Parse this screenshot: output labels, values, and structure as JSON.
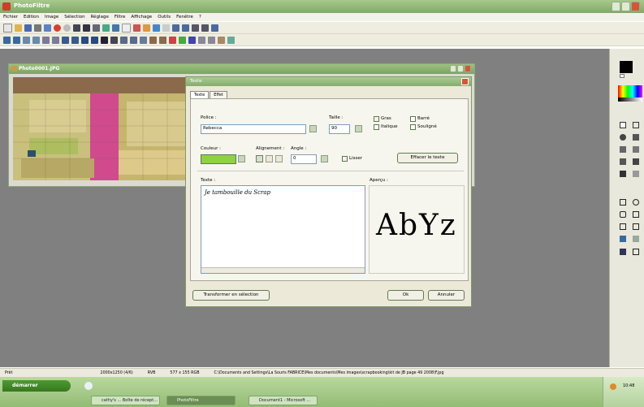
{
  "app": {
    "title": "PhotoFiltre"
  },
  "menu": [
    "Fichier",
    "Edition",
    "Image",
    "Sélection",
    "Réglage",
    "Filtre",
    "Affichage",
    "Outils",
    "Fenêtre",
    "?"
  ],
  "doc": {
    "title": "Photo0001.JPG"
  },
  "dialog": {
    "title": "Texte",
    "tabs": [
      "Texte",
      "Effet"
    ],
    "police_label": "Police :",
    "police_value": "Rebecca",
    "taille_label": "Taille :",
    "taille_value": "90",
    "gras": "Gras",
    "italique": "Italique",
    "barre": "Barré",
    "souligne": "Souligné",
    "couleur_label": "Couleur :",
    "alignement_label": "Alignement :",
    "angle_label": "Angle :",
    "angle_value": "0",
    "lisser": "Lisser",
    "effacer_btn": "Effacer le texte",
    "texte_label": "Texte :",
    "texte_value": "Je tambouille du Scrap",
    "apercu_label": "Aperçu :",
    "apercu_sample": "AbYz",
    "transform_btn": "Transformer en sélection",
    "ok_btn": "Ok",
    "annuler_btn": "Annuler",
    "color_swatch": "#8fd13f"
  },
  "status": {
    "ready": "Prêt",
    "size": "2000x1250 (4/6)",
    "mode": "RVB",
    "coords": "577 x 155 RGB",
    "path": "C:\\Documents and Settings\\La Souris FABRICE\\Mes documents\\Mes images\\scrapbooking\\kit de JB page 49 2008\\F.jpg"
  },
  "taskbar": {
    "start": "démarrer",
    "tasks": [
      "cathy's ... Boîte de récept...",
      "PhotoFiltre",
      "Document1 - Microsoft ..."
    ],
    "clock": "10:48"
  },
  "colors": {
    "accent": "#7aa465",
    "workspace": "#808080"
  }
}
